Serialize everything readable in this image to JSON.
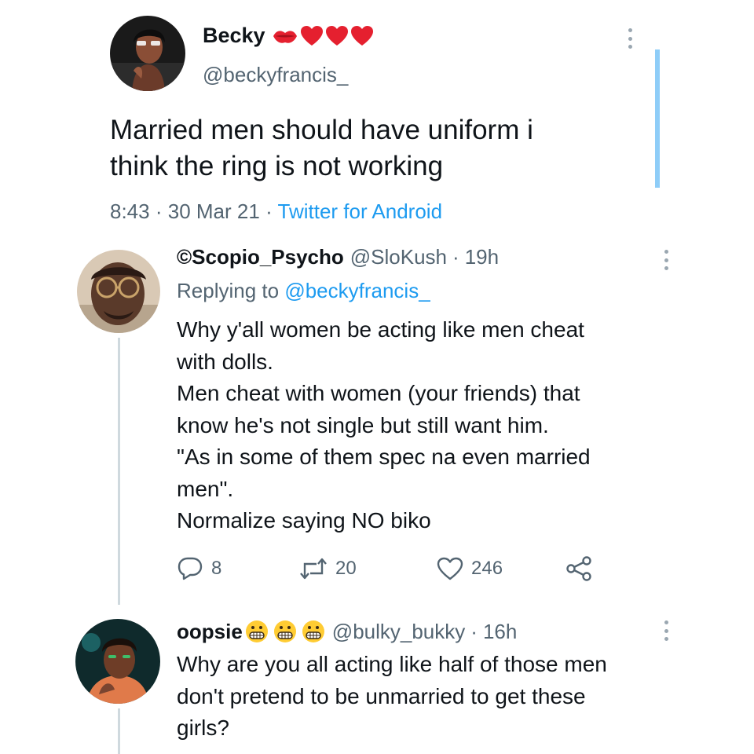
{
  "colors": {
    "accent": "#1d9bf0",
    "secondary_text": "#536471",
    "primary_text": "#0f1419",
    "heart_emoji": "#e5202f",
    "thread_accent": "#8ecdf8"
  },
  "main_tweet": {
    "author_name": "Becky",
    "author_emojis": [
      "lips-emoji",
      "red-heart-emoji",
      "red-heart-emoji",
      "red-heart-emoji"
    ],
    "handle": "@beckyfrancis_",
    "text_line1": "Married men should have uniform i",
    "text_line2": "think the ring is not working",
    "time": "8:43",
    "date": "30 Mar 21",
    "source": "Twitter for Android",
    "separator": "·"
  },
  "reply1": {
    "author_name": "©Scopio_Psycho",
    "handle": "@SloKush",
    "time_ago": "19h",
    "separator": "·",
    "replying_prefix": "Replying to",
    "replying_mention": "@beckyfrancis_",
    "lines": [
      "Why y'all women be acting like men cheat",
      "with dolls.",
      "Men cheat with women (your friends) that",
      "know he's not single but still want him.",
      "\"As in some of them spec na even married",
      "men\".",
      "Normalize saying NO biko"
    ],
    "reply_count": "8",
    "retweet_count": "20",
    "like_count": "246"
  },
  "reply2": {
    "author_name": "oopsie",
    "author_emojis": [
      "grimacing-face-emoji",
      "grimacing-face-emoji",
      "grimacing-face-emoji"
    ],
    "handle": "@bulky_bukky",
    "time_ago": "16h",
    "separator": "·",
    "lines": [
      "Why are you all acting like half of those men",
      "don't pretend to be unmarried to get these",
      "girls?"
    ]
  }
}
